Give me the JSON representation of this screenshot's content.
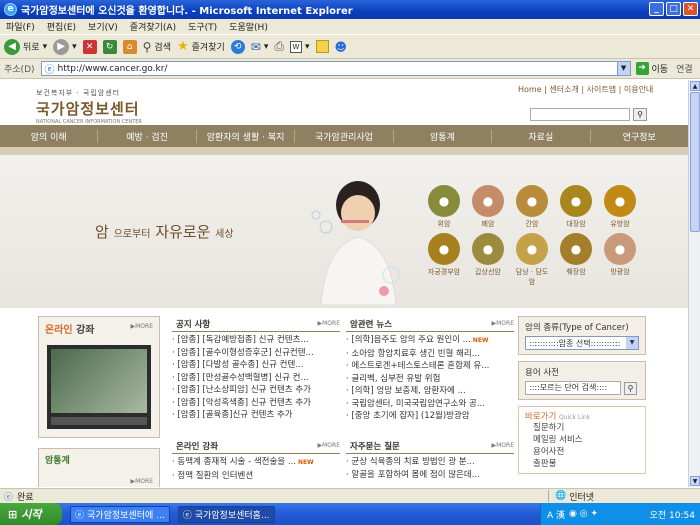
{
  "window": {
    "title": "국가암정보센터에 오신것을 환영합니다. - Microsoft Internet Explorer"
  },
  "menu": [
    "파일(F)",
    "편집(E)",
    "보기(V)",
    "즐겨찾기(A)",
    "도구(T)",
    "도움말(H)"
  ],
  "toolbar": {
    "back": "뒤로",
    "search": "검색",
    "favorites": "즐겨찾기"
  },
  "address": {
    "label": "주소(D)",
    "url": "http://www.cancer.go.kr/",
    "go": "이동",
    "links": "연결"
  },
  "site": {
    "logo_sub": "보건복지부 · 국립암센터",
    "logo_main": "국가암정보센터",
    "logo_en": "NATIONAL CANCER INFORMATION CENTER",
    "toplinks": "Home | 센터소개 | 사이트맵 | 이용안내",
    "nav": [
      "암의 이해",
      "예방 · 검진",
      "암환자의 생활 · 복지",
      "국가암관리사업",
      "암통계",
      "자료실",
      "연구정보"
    ],
    "slogan_a": "암",
    "slogan_b": "으로부터",
    "slogan_c": "자유로운",
    "slogan_d": "세상",
    "cancers_row1": [
      {
        "name": "위암",
        "color": "#8a8a3c"
      },
      {
        "name": "폐암",
        "color": "#c58c6a"
      },
      {
        "name": "간암",
        "color": "#b88c3a"
      },
      {
        "name": "대장암",
        "color": "#a8871f"
      },
      {
        "name": "유방암",
        "color": "#c28a14"
      }
    ],
    "cancers_row2": [
      {
        "name": "자궁경부암",
        "color": "#a67f1e"
      },
      {
        "name": "갑상선암",
        "color": "#9c8b3c"
      },
      {
        "name": "담낭 · 담도암",
        "color": "#c5a24a"
      },
      {
        "name": "췌장암",
        "color": "#a57e2a"
      },
      {
        "name": "방광암",
        "color": "#c99a7a"
      }
    ],
    "online": {
      "title_a": "온라인",
      "title_b": "강좌",
      "more": "▶MORE"
    },
    "stats": {
      "label": "암통계",
      "more": "▶MORE"
    },
    "notice": {
      "title": "공지 사항",
      "more": "▶MORE",
      "items": [
        "[암종] [독감예방접종] 신규 컨텐츠...",
        "[암종] [골수이형성증후군] 신규컨텐...",
        "[암종] [다발성 골수종] 신규 컨텐...",
        "[암종] [만성골수성백혈병] 신규 컨...",
        "[암종] [난소상피암] 신규 컨텐츠 추가",
        "[암종] [악성흑색종] 신규 컨텐츠 추가",
        "[암종] [골육종]신규 컨텐츠 추가"
      ]
    },
    "news": {
      "title": "암관련 뉴스",
      "more": "▶MORE",
      "items": [
        "[의학]음주도 암의 주요 원인이 ...",
        "소아암 항암치료후 생긴 빈혈 해리...",
        "에스트로겐+테스토스테론 혼합제 유...",
        "글리벡, 심부전 유발 위험",
        "[의학] 엉망 보충제, 암환자에 ...",
        "국립암센터, 미국국립암연구소와 공...",
        "[중앙 초기에 잡자] (12월)방광암"
      ],
      "new_index": 0
    },
    "online2": {
      "title": "온라인 강좌",
      "more": "▶MORE",
      "items": [
        "동맥계 종재적 시술 - 색전술을 ...",
        "정맥 질환의 인터벤션"
      ]
    },
    "faq": {
      "title": "자주묻는 질문",
      "more": "▶MORE",
      "items": [
        "균상 식육종의 치료 방법인 광 분...",
        "알골을 포함하여 몸에 점이 많은데..."
      ]
    },
    "cancer_type": {
      "title": "암의 종류(Type of Cancer)",
      "select": ":::::::::::암종 선택:::::::::::"
    },
    "dictionary": {
      "title": "용어 사전",
      "placeholder": "::::모르는 단어 검색::::"
    },
    "quick": {
      "title": "바로가기",
      "title_en": "Quick Link",
      "items": [
        "질문하기",
        "메일링 서비스",
        "용어사전",
        "출판물"
      ]
    },
    "new_badge": "NEW"
  },
  "status": {
    "text": "완료",
    "zone": "인터넷"
  },
  "taskbar": {
    "start": "시작",
    "tasks": [
      "국가암정보센터에 ...",
      "국가암정보센터홈..."
    ],
    "ime": "A 漢",
    "clock": "오전 10:54"
  }
}
